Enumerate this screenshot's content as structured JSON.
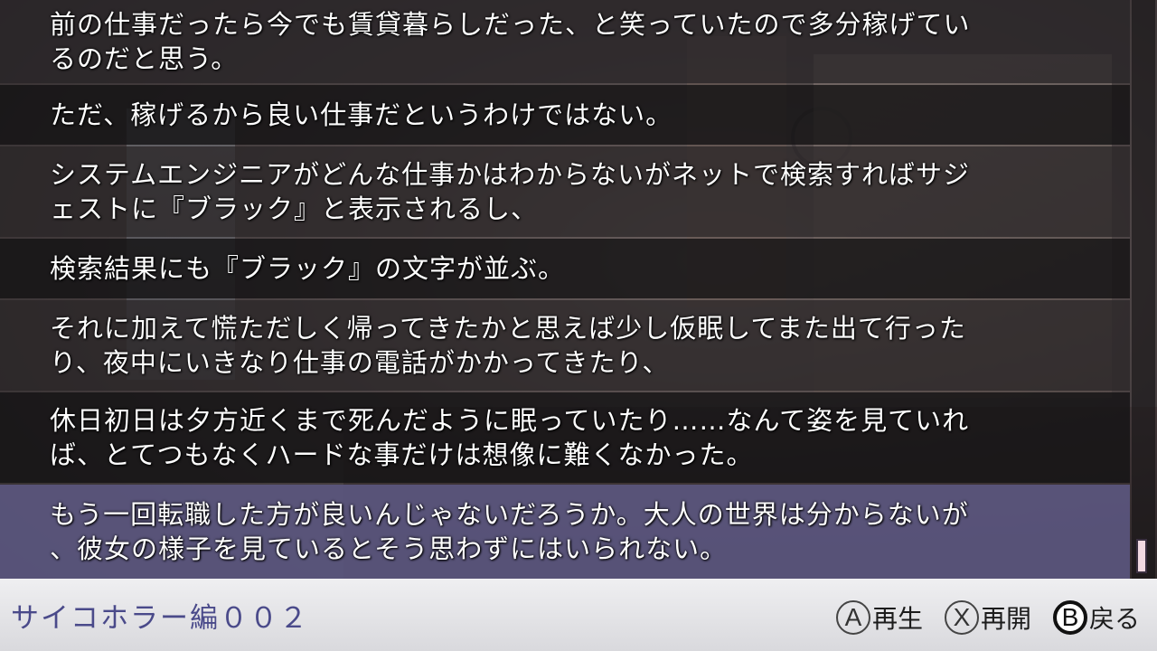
{
  "backlog": [
    {
      "lines": [
        "前の仕事だったら今でも賃貸暮らしだった、と笑っていたので多分稼げてい",
        "るのだと思う。"
      ]
    },
    {
      "lines": [
        "ただ、稼げるから良い仕事だというわけではない。"
      ]
    },
    {
      "lines": [
        "システムエンジニアがどんな仕事かはわからないがネットで検索すればサジ",
        "ェストに『ブラック』と表示されるし、"
      ]
    },
    {
      "lines": [
        "検索結果にも『ブラック』の文字が並ぶ。"
      ]
    },
    {
      "lines": [
        "それに加えて慌ただしく帰ってきたかと思えば少し仮眠してまた出て行った",
        "り、夜中にいきなり仕事の電話がかかってきたり、"
      ]
    },
    {
      "lines": [
        "休日初日は夕方近くまで死んだように眠っていたり……なんて姿を見ていれ",
        "ば、とてつもなくハードな事だけは想像に難くなかった。"
      ]
    },
    {
      "lines": [
        "もう一回転職した方が良いんじゃないだろうか。大人の世界は分からないが",
        "、彼女の様子を見ているとそう思わずにはいられない。"
      ]
    }
  ],
  "footer": {
    "chapter": "サイコホラー編００２",
    "buttons": {
      "a": {
        "key": "A",
        "label": "再生",
        "icon": "a-button-icon"
      },
      "x": {
        "key": "X",
        "label": "再開",
        "icon": "x-button-icon"
      },
      "b": {
        "key": "B",
        "label": "戻る",
        "icon": "b-button-icon"
      }
    }
  },
  "colors": {
    "selected_row": "#5c5882",
    "chapter_text": "#4a4a8a",
    "scroll_thumb": "#f1d9e1"
  }
}
